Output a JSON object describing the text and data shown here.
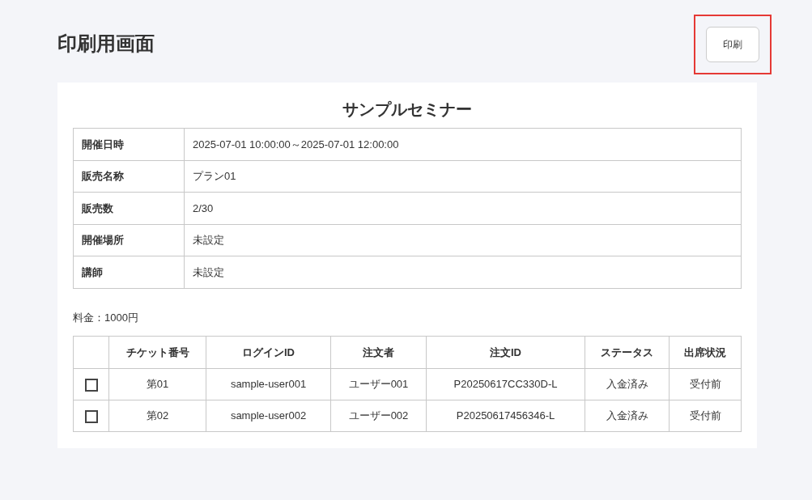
{
  "page_title": "印刷用画面",
  "print_button": {
    "label": "印刷",
    "highlighted": true
  },
  "seminar_title": "サンプルセミナー",
  "details": [
    {
      "label": "開催日時",
      "value": "2025-07-01 10:00:00～2025-07-01 12:00:00"
    },
    {
      "label": "販売名称",
      "value": "プラン01"
    },
    {
      "label": "販売数",
      "value": "2/30"
    },
    {
      "label": "開催場所",
      "value": "未設定"
    },
    {
      "label": "講師",
      "value": "未設定"
    }
  ],
  "fee": "料金：1000円",
  "orders": {
    "columns": [
      "チケット番号",
      "ログインID",
      "注文者",
      "注文ID",
      "ステータス",
      "出席状況"
    ],
    "rows": [
      {
        "checked": false,
        "cells": [
          "第01",
          "sample-user001",
          "ユーザー001",
          "P20250617CC330D-L",
          "入金済み",
          "受付前"
        ]
      },
      {
        "checked": false,
        "cells": [
          "第02",
          "sample-user002",
          "ユーザー002",
          "P20250617456346-L",
          "入金済み",
          "受付前"
        ]
      }
    ]
  }
}
